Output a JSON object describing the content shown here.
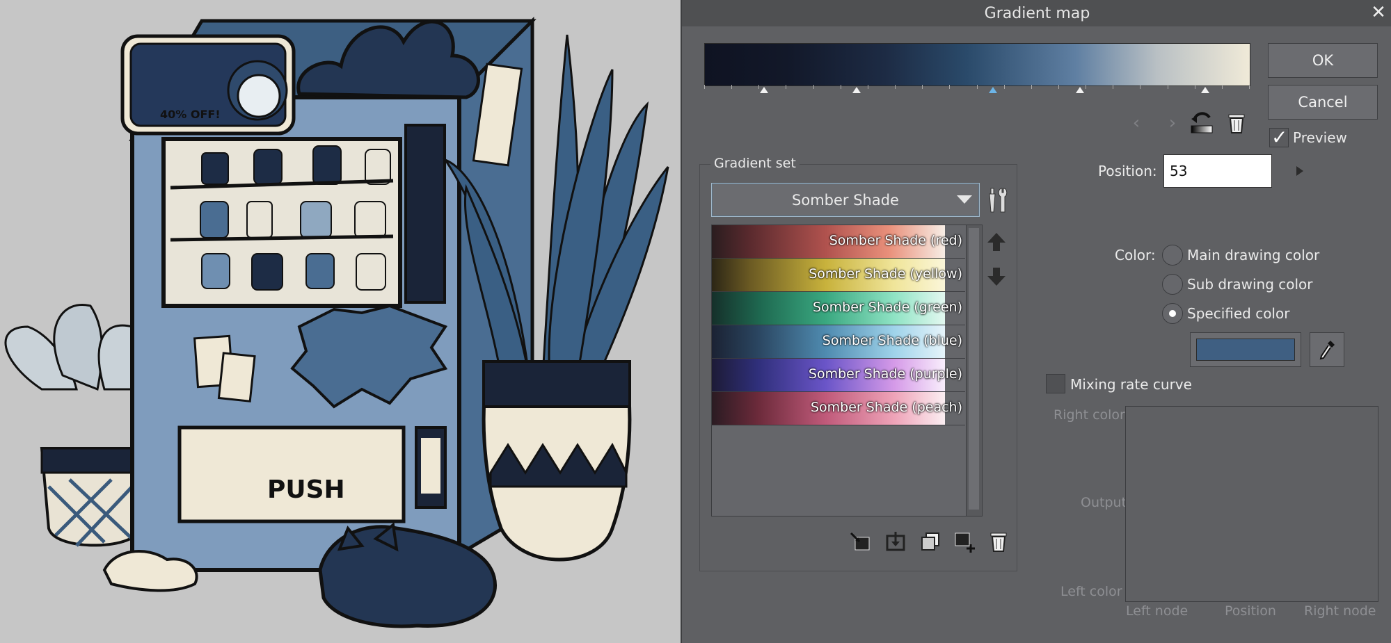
{
  "dialog": {
    "title": "Gradient map",
    "close_icon": "close-icon",
    "ok_label": "OK",
    "cancel_label": "Cancel",
    "preview_label": "Preview",
    "preview_checked": true,
    "gradient_nodes": [
      {
        "value": 11,
        "active": false
      },
      {
        "value": 28,
        "active": false
      },
      {
        "value": 53,
        "active": true
      },
      {
        "value": 69,
        "active": false
      },
      {
        "value": 92,
        "active": false
      }
    ],
    "gradient_set": {
      "title": "Gradient set",
      "selected": "Somber Shade",
      "items": [
        {
          "label": "Somber Shade (red)"
        },
        {
          "label": "Somber Shade (yellow)"
        },
        {
          "label": "Somber Shade (green)"
        },
        {
          "label": "Somber Shade (blue)"
        },
        {
          "label": "Somber Shade (purple)"
        },
        {
          "label": "Somber Shade (peach)"
        }
      ]
    },
    "position_label": "Position:",
    "position_value": "53",
    "color_label": "Color:",
    "color_options": [
      {
        "label": "Main drawing color",
        "checked": false
      },
      {
        "label": "Sub drawing color",
        "checked": false
      },
      {
        "label": "Specified color",
        "checked": true
      }
    ],
    "specified_color": "#3f5f82",
    "mixing_rate_label": "Mixing rate curve",
    "mixing_rate_checked": false,
    "curve": {
      "right_color": "Right color",
      "output": "Output",
      "left_color": "Left color",
      "left_node": "Left node",
      "position": "Position",
      "right_node": "Right node"
    }
  },
  "canvas": {
    "sign_text": "40% OFF!",
    "push_text": "PUSH"
  }
}
